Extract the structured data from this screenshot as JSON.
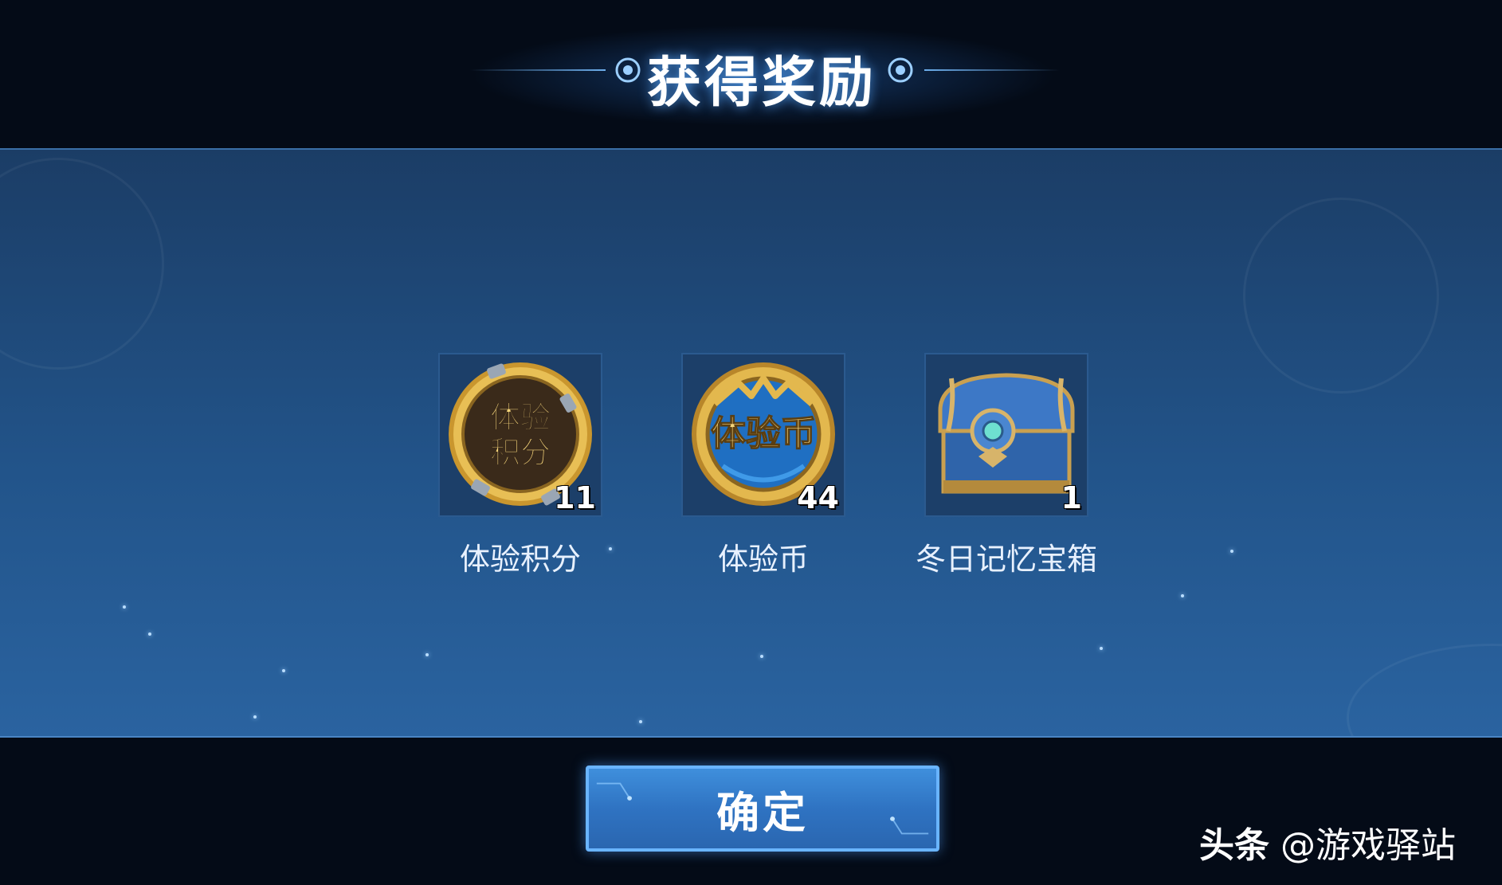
{
  "title": "获得奖励",
  "rewards": [
    {
      "label": "体验积分",
      "count": "11",
      "icon": "experience-points-coin-icon",
      "icon_text": [
        "体验",
        "积分"
      ]
    },
    {
      "label": "体验币",
      "count": "44",
      "icon": "experience-coin-icon",
      "icon_text": [
        "体验币"
      ]
    },
    {
      "label": "冬日记忆宝箱",
      "count": "1",
      "icon": "treasure-chest-icon"
    }
  ],
  "confirm_label": "确定",
  "watermark": {
    "brand": "头条",
    "handle": "@游戏驿站"
  },
  "colors": {
    "panel": "#22548a",
    "button": "#3f8fdc",
    "button_border": "#69b4ff",
    "coin_gold": "#d9a640"
  }
}
